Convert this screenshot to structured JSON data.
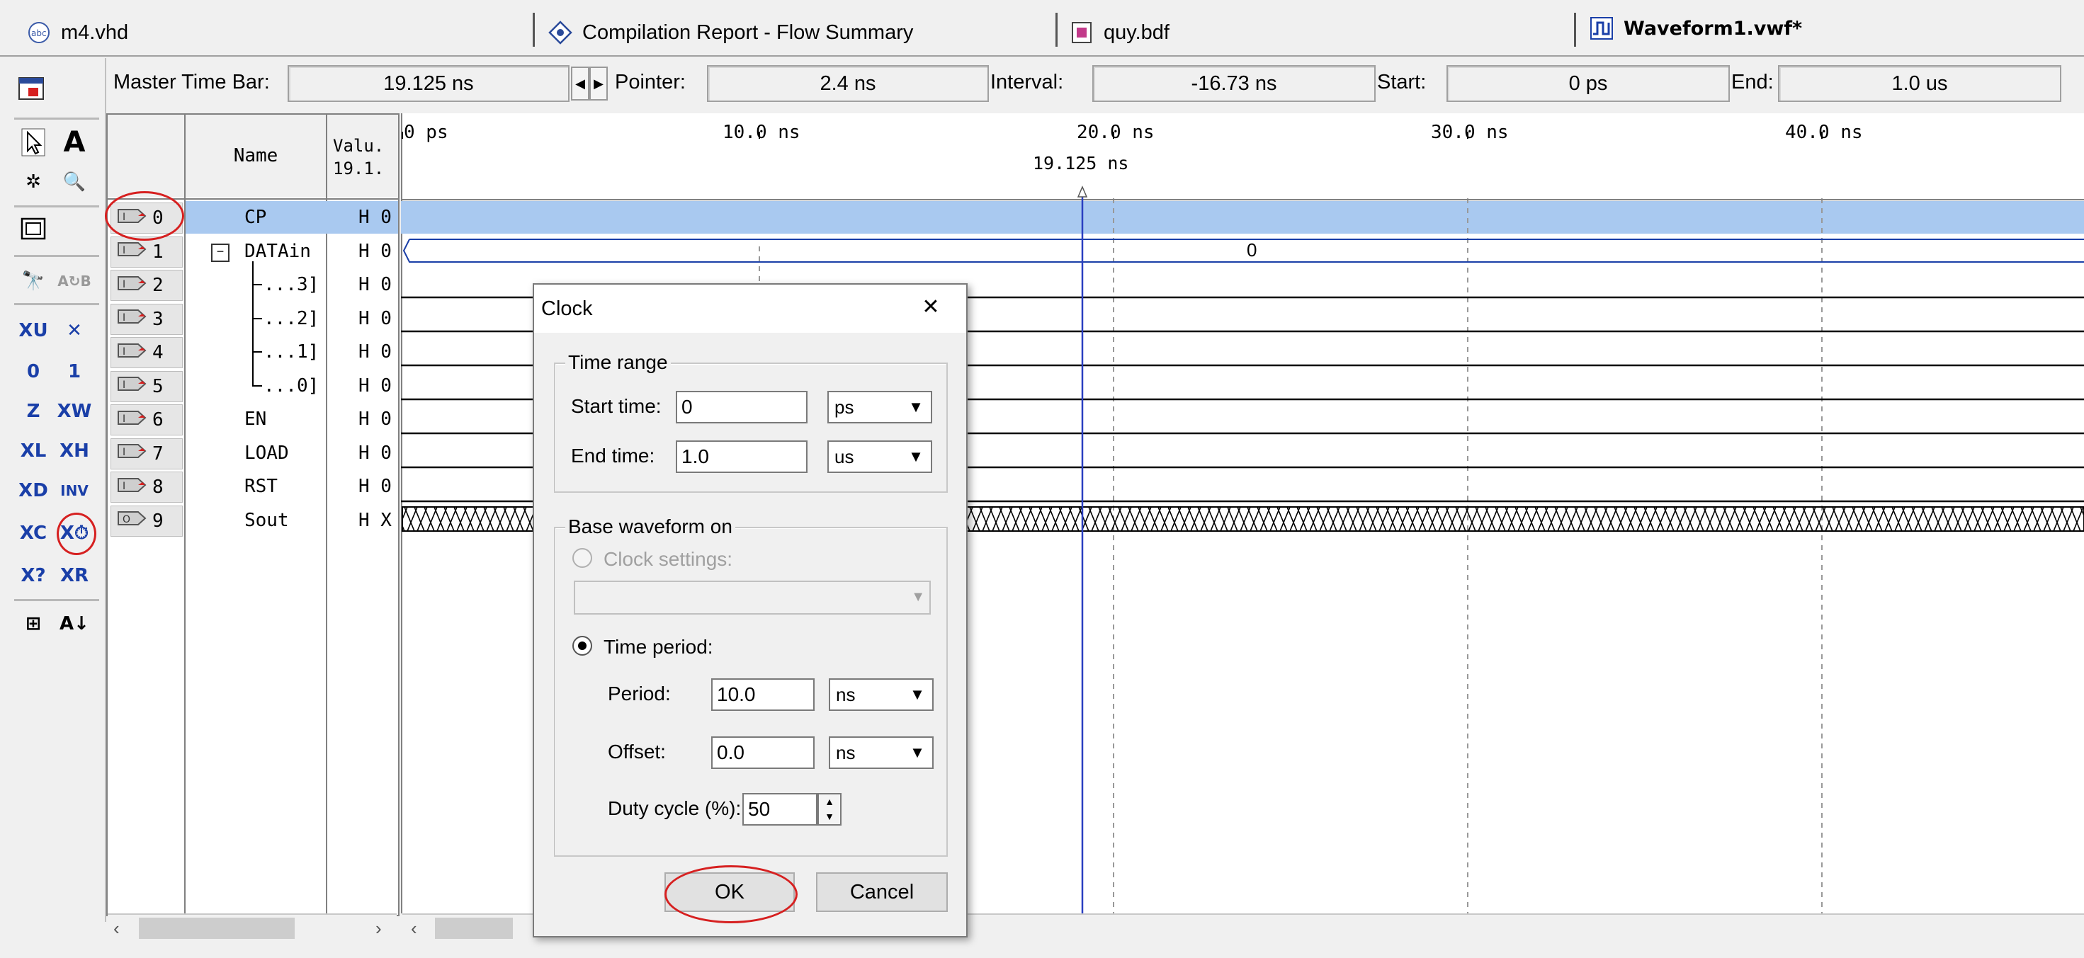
{
  "tabs": [
    {
      "label": "m4.vhd",
      "icon": "abc-icon"
    },
    {
      "label": "Compilation Report - Flow Summary",
      "icon": "report-icon"
    },
    {
      "label": "quy.bdf",
      "icon": "bdf-icon"
    },
    {
      "label": "Waveform1.vwf*",
      "icon": "waveform-icon"
    }
  ],
  "timebar": {
    "master_label": "Master Time Bar:",
    "master_value": "19.125 ns",
    "pointer_label": "Pointer:",
    "pointer_value": "2.4 ns",
    "interval_label": "Interval:",
    "interval_value": "-16.73 ns",
    "start_label": "Start:",
    "start_value": "0 ps",
    "end_label": "End:",
    "end_value": "1.0 us"
  },
  "table": {
    "name_header": "Name",
    "value_header_1": "Valu.",
    "value_header_2": "19.1.",
    "rows": [
      {
        "index": "0",
        "name": "CP",
        "value": "H 0"
      },
      {
        "index": "1",
        "name": "DATAin",
        "value": "H 0"
      },
      {
        "index": "2",
        "name": "...3]",
        "value": "H 0"
      },
      {
        "index": "3",
        "name": "...2]",
        "value": "H 0"
      },
      {
        "index": "4",
        "name": "...1]",
        "value": "H 0"
      },
      {
        "index": "5",
        "name": "...0]",
        "value": "H 0"
      },
      {
        "index": "6",
        "name": "EN",
        "value": "H 0"
      },
      {
        "index": "7",
        "name": "LOAD",
        "value": "H 0"
      },
      {
        "index": "8",
        "name": "RST",
        "value": "H 0"
      },
      {
        "index": "9",
        "name": "Sout",
        "value": "H X"
      }
    ]
  },
  "ruler": {
    "ticks": [
      "0 ps",
      "10.0 ns",
      "20.0 ns",
      "30.0 ns",
      "40.0 ns"
    ],
    "marker": "19.125 ns",
    "datain_value": "0"
  },
  "dialog": {
    "title": "Clock",
    "close": "✕",
    "time_range": "Time range",
    "start_time_label": "Start time:",
    "start_time_value": "0",
    "start_unit": "ps",
    "end_time_label": "End time:",
    "end_time_value": "1.0",
    "end_unit": "us",
    "base_waveform": "Base waveform on",
    "clock_settings": "Clock settings:",
    "time_period": "Time period:",
    "period_label": "Period:",
    "period_value": "10.0",
    "period_unit": "ns",
    "offset_label": "Offset:",
    "offset_value": "0.0",
    "offset_unit": "ns",
    "duty_label": "Duty cycle (%):",
    "duty_value": "50",
    "ok": "OK",
    "cancel": "Cancel"
  },
  "colors": {
    "selection": "#a9c9f0",
    "marker": "#2a3fc0",
    "annotation": "#d62020"
  }
}
